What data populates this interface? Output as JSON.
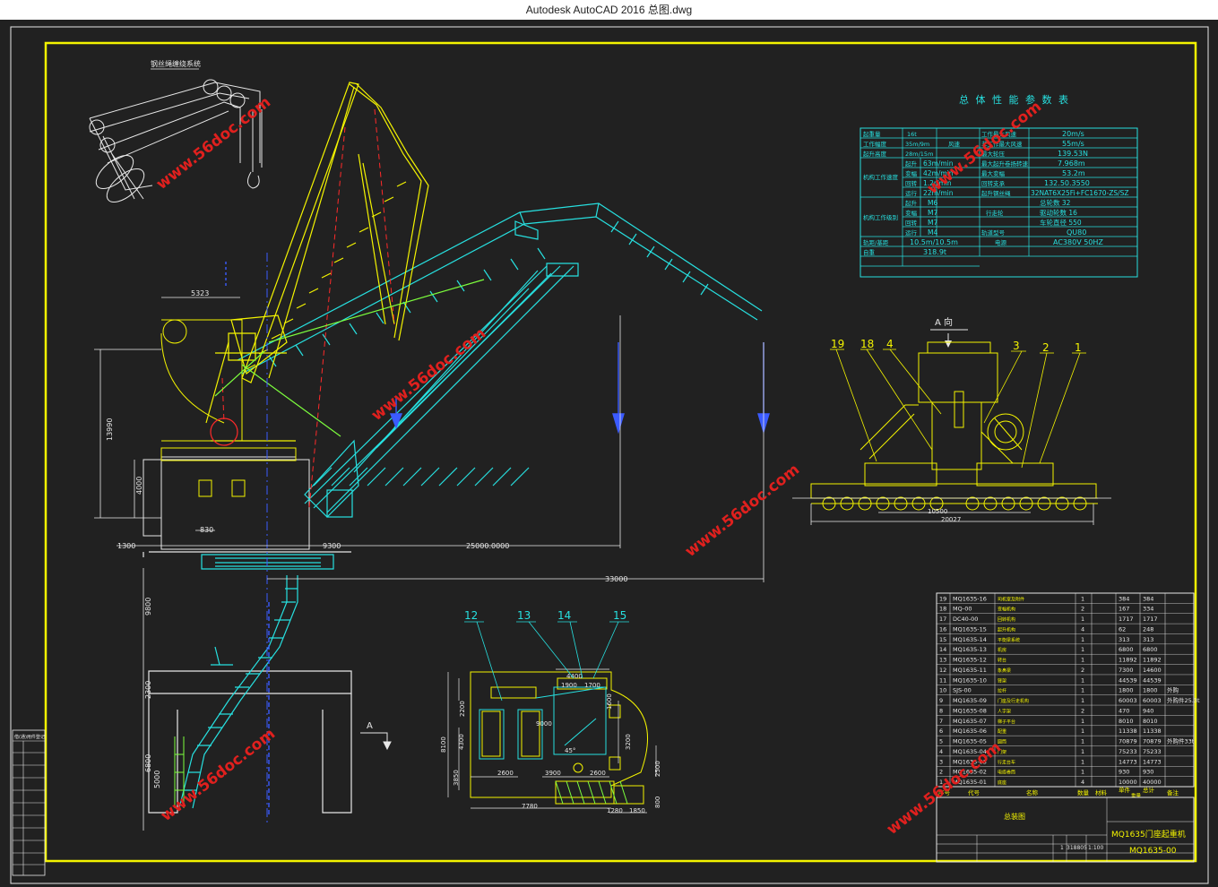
{
  "window": {
    "title": "Autodesk AutoCAD 2016     总图.dwg"
  },
  "watermark": {
    "text": "www.56doc.com",
    "color": "#e0201e"
  },
  "colors": {
    "background": "#212121",
    "frame": "#f4f400",
    "cyan": "#27e0e0",
    "red": "#ff2a2a",
    "green": "#7dff3d",
    "blue": "#3b5bff"
  },
  "drawing": {
    "detail_title": "钢丝绳缠绕系统",
    "perf_title": "总 体 性 能 参 数 表",
    "dims": {
      "d5323": "5323",
      "d13990": "13990",
      "d4000": "4000",
      "d830": "830",
      "d1300": "1300",
      "d9300": "9300",
      "d25000_0000": "25000.0000",
      "d33000": "33000",
      "d9800": "9800",
      "d2300": "2300",
      "d6800": "6800",
      "d5000": "5000",
      "d10500": "10500",
      "d20027": "20027",
      "d4400": "4400",
      "d2200": "2200",
      "d8100": "8100",
      "d4300": "4300",
      "d3850": "3850",
      "d2600a": "2600",
      "d3900": "3900",
      "d2600b": "2600",
      "d7780": "7780",
      "d3200": "3200",
      "d2500": "2500",
      "d1900": "1900",
      "d1700": "1700",
      "d1600": "1600",
      "d800": "800",
      "d1280": "1280",
      "d1850": "1850",
      "d9000": "9000",
      "ang": "45°"
    },
    "view_label": "A 向",
    "section_label": "A",
    "callouts_a": [
      "19",
      "18",
      "4",
      "3",
      "2",
      "1"
    ],
    "callouts_b": [
      "12",
      "13",
      "14",
      "15"
    ]
  },
  "perf_table": {
    "rows": [
      [
        "起重量",
        "16t",
        "风速",
        "工作最大风速",
        "20m/s"
      ],
      [
        "工作幅度",
        "35m/9m",
        "",
        "非工作最大风速",
        "55m/s"
      ],
      [
        "起升高度",
        "28m/15m",
        "",
        "最大轮压",
        "139.53N"
      ],
      [
        "机构工作速度",
        "起升",
        "63m/min",
        "最大起升卷扬转速",
        "7.968m"
      ],
      [
        "",
        "变幅",
        "42m/min",
        "最大变幅",
        "53.2m"
      ],
      [
        "",
        "回转",
        "1.2r/min",
        "回转支承",
        "132.50.3550"
      ],
      [
        "",
        "运行",
        "22m/min",
        "起升钢丝绳",
        "32NAT6X25Fi+FC1670-ZS/SZ"
      ],
      [
        "机构工作级别",
        "起升",
        "M6",
        "行走轮",
        "总轮数 32"
      ],
      [
        "",
        "变幅",
        "M7",
        "",
        "驱动轮数 16"
      ],
      [
        "",
        "回转",
        "M7",
        "",
        "车轮直径 550"
      ],
      [
        "",
        "运行",
        "M4",
        "轨道型号",
        "QU80"
      ],
      [
        "轨距/基距",
        "10.5m/10.5m",
        "",
        "电源",
        "AC380V 50HZ"
      ],
      [
        "自重",
        "318.9t",
        "",
        "",
        ""
      ]
    ]
  },
  "parts_list": {
    "rows": [
      [
        "19",
        "MQ1635-16",
        "司机室及附件",
        "1",
        "",
        "384",
        "384",
        ""
      ],
      [
        "18",
        "MQ-00",
        "变幅机构",
        "2",
        "",
        "167",
        "334",
        ""
      ],
      [
        "17",
        "DC40-00",
        "回转机构",
        "1",
        "",
        "1717",
        "1717",
        ""
      ],
      [
        "16",
        "MQ1635-15",
        "起升机构",
        "4",
        "",
        "62",
        "248",
        ""
      ],
      [
        "15",
        "MQ1635-14",
        "平衡梁系统",
        "1",
        "",
        "313",
        "313",
        ""
      ],
      [
        "14",
        "MQ1635-13",
        "机房",
        "1",
        "",
        "6800",
        "6800",
        ""
      ],
      [
        "13",
        "MQ1635-12",
        "转台",
        "1",
        "",
        "11892",
        "11892",
        ""
      ],
      [
        "12",
        "MQ1635-11",
        "象鼻梁",
        "2",
        "",
        "7300",
        "14600",
        ""
      ],
      [
        "11",
        "MQ1635-10",
        "臂架",
        "1",
        "",
        "44539",
        "44539",
        ""
      ],
      [
        "10",
        "SJS-00",
        "拉杆",
        "1",
        "",
        "1800",
        "1800",
        "外购"
      ],
      [
        "9",
        "MQ1635-09",
        "门座及行走机构",
        "1",
        "",
        "60003",
        "60003",
        "外购件25.3t"
      ],
      [
        "8",
        "MQ1635-08",
        "人字架",
        "2",
        "",
        "470",
        "940",
        ""
      ],
      [
        "7",
        "MQ1635-07",
        "梯子平台",
        "1",
        "",
        "8010",
        "8010",
        ""
      ],
      [
        "6",
        "MQ1635-06",
        "配重",
        "1",
        "",
        "11338",
        "11338",
        ""
      ],
      [
        "5",
        "MQ1635-05",
        "圆筒",
        "1",
        "",
        "70879",
        "70879",
        "外购件33t"
      ],
      [
        "4",
        "MQ1635-04",
        "门架",
        "1",
        "",
        "75233",
        "75233",
        ""
      ],
      [
        "3",
        "MQ1635-03",
        "行走台车",
        "1",
        "",
        "14773",
        "14773",
        ""
      ],
      [
        "2",
        "MQ1635-02",
        "电缆卷筒",
        "1",
        "",
        "930",
        "930",
        ""
      ],
      [
        "1",
        "MQ1635-01",
        "底座",
        "4",
        "",
        "10000",
        "40000",
        ""
      ]
    ],
    "header": [
      "序号",
      "代号",
      "名称",
      "数量",
      "材料",
      "单件",
      "总计",
      "备注"
    ],
    "weight_label": "重量",
    "assembly_label": "总装图",
    "title_name": "MQ1635门座起重机",
    "drawing_no": "MQ1635-00",
    "mass": "318805",
    "scale": "1:100",
    "qty": "1"
  },
  "left_table": {
    "rows": [
      "借(通)用件登记",
      "",
      "",
      "",
      "",
      "",
      "",
      "",
      "",
      "",
      ""
    ]
  }
}
